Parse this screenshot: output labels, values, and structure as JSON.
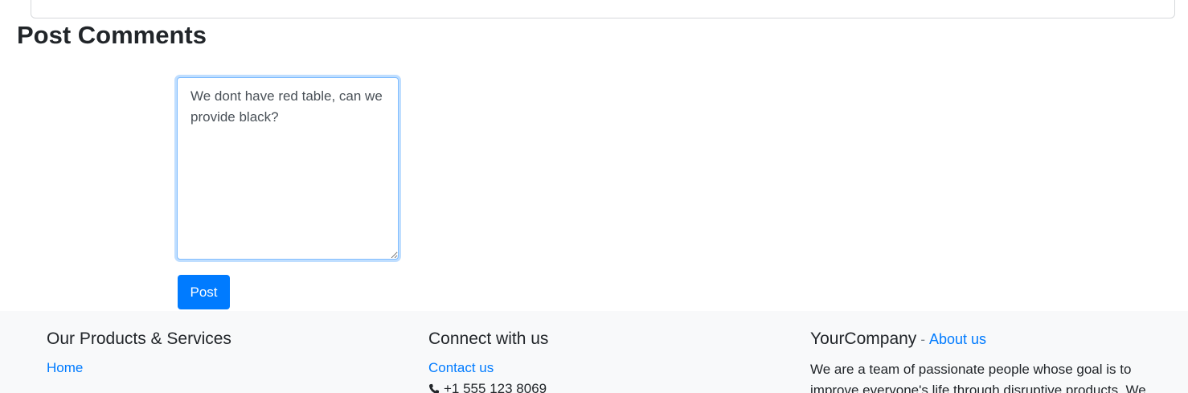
{
  "comments": {
    "title": "Post Comments",
    "textarea_value": "We dont have red table, can we provide black?",
    "post_label": "Post"
  },
  "footer": {
    "products": {
      "heading": "Our Products & Services",
      "link_home": "Home"
    },
    "connect": {
      "heading": "Connect with us",
      "link_contact": "Contact us",
      "phone": "+1 555 123 8069",
      "phone_icon": "phone-icon"
    },
    "company": {
      "name": "YourCompany",
      "separator": "-",
      "about_link": "About us",
      "description": "We are a team of passionate people whose goal is to improve everyone's life through disruptive products. We"
    }
  },
  "colors": {
    "primary": "#007bff",
    "footer_bg": "#f8f9fa",
    "text": "#212529"
  }
}
